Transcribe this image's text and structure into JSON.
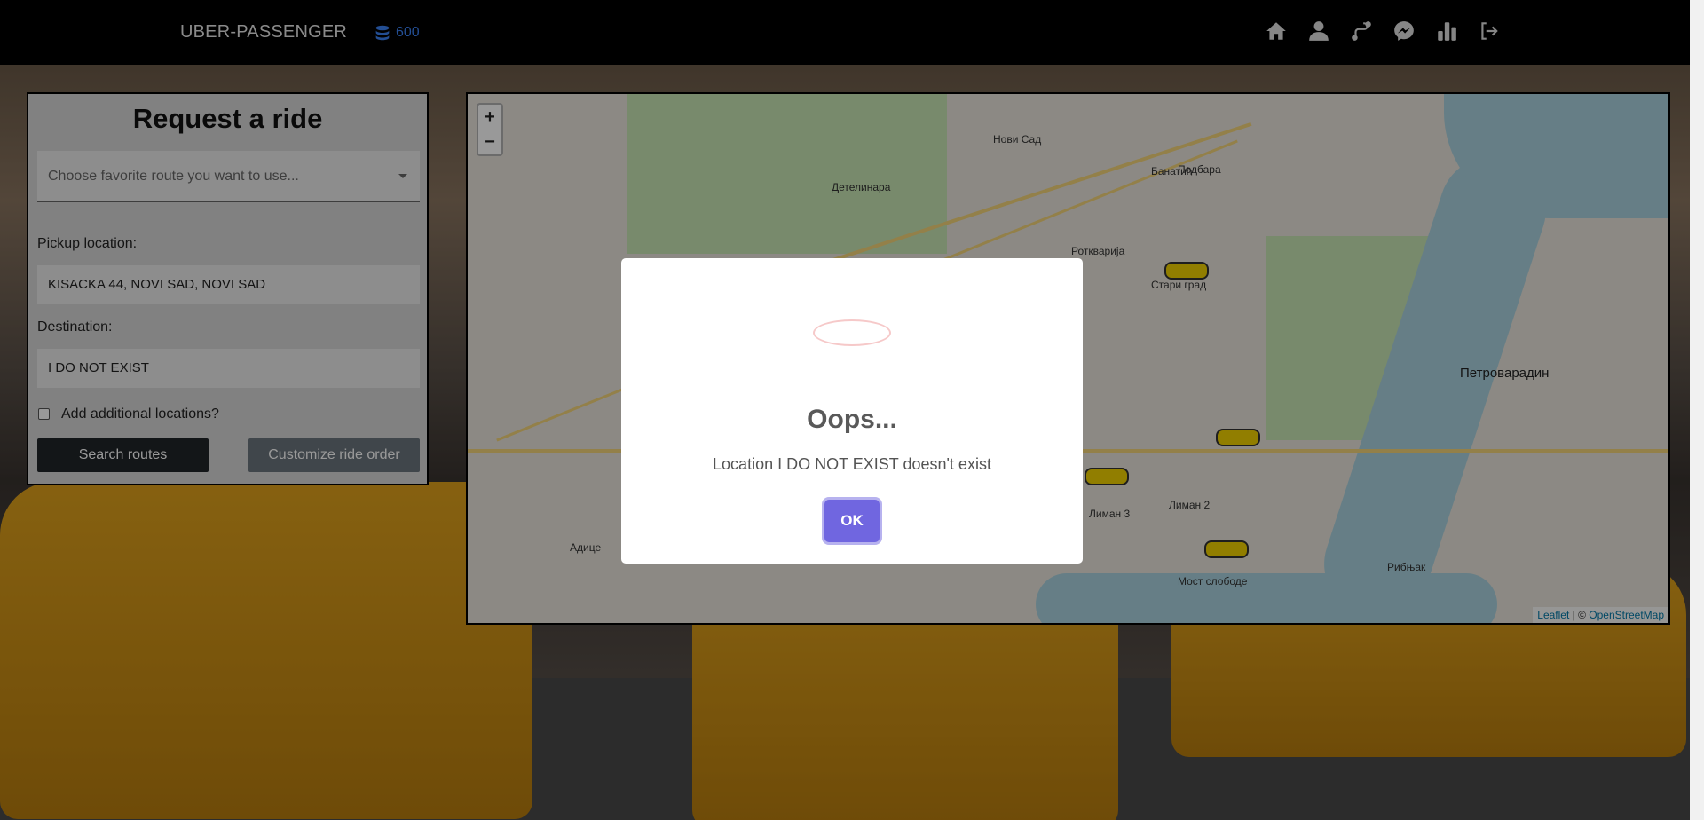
{
  "navbar": {
    "brand": "UBER-PASSENGER",
    "coins": "600",
    "icons": [
      "home-icon",
      "user-icon",
      "route-icon",
      "messenger-icon",
      "chart-icon",
      "logout-icon"
    ]
  },
  "panel": {
    "title": "Request a ride",
    "favorite_placeholder": "Choose favorite route you want to use...",
    "pickup_label": "Pickup location:",
    "pickup_value": "KISACKA 44, NOVI SAD, NOVI SAD",
    "destination_label": "Destination:",
    "destination_value": "I DO NOT EXIST",
    "additional_label": "Add additional locations?",
    "search_button": "Search routes",
    "customize_button": "Customize ride order"
  },
  "map": {
    "zoom_in": "+",
    "zoom_out": "−",
    "attribution_leaflet": "Leaflet",
    "attribution_sep": " | © ",
    "attribution_osm": "OpenStreetMap",
    "labels": {
      "novi_sad": "Нови Сад",
      "stari_grad": "Стари град",
      "petrovaradin": "Петроварадин",
      "liman2": "Лиман 2",
      "liman3": "Лиман 3",
      "most_slobode": "Мост слободе",
      "detelinara": "Детелинара",
      "banatic": "Банатић",
      "rotkvarija": "Ротквари­ја",
      "podbara": "Подбара",
      "adice": "Адице",
      "ribnjak": "Рибњак"
    }
  },
  "modal": {
    "title": "Oops...",
    "message": "Location I DO NOT EXIST doesn't exist",
    "ok": "OK"
  }
}
